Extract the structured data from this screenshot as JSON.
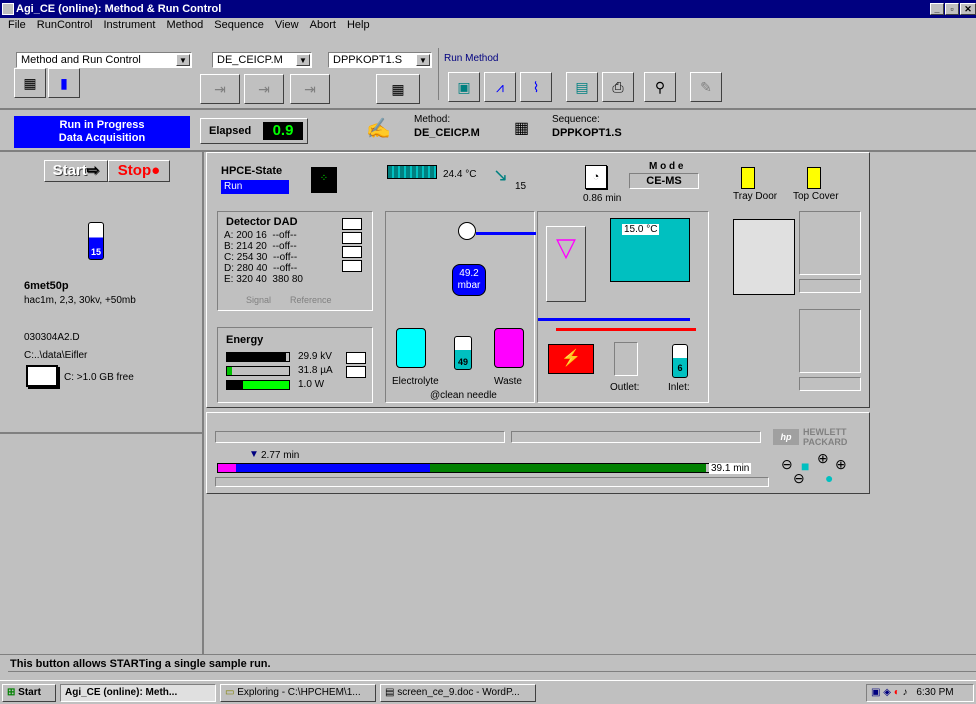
{
  "window": {
    "title": "Agi_CE (online): Method & Run Control"
  },
  "menu": [
    "File",
    "RunControl",
    "Instrument",
    "Method",
    "Sequence",
    "View",
    "Abort",
    "Help"
  ],
  "toolbar": {
    "view_select": "Method and Run Control",
    "method_select": "DE_CEICP.M",
    "sequence_select": "DPPKOPT1.S",
    "run_method_label": "Run Method"
  },
  "status": {
    "line1": "Run in Progress",
    "line2": "Data Acquisition",
    "elapsed_label": "Elapsed",
    "elapsed_value": "0.9",
    "method_label": "Method:",
    "method_value": "DE_CEICP.M",
    "sequence_label": "Sequence:",
    "sequence_value": "DPPKOPT1.S"
  },
  "left": {
    "start_label": "Start",
    "stop_label": "Stop",
    "vial_number": "15",
    "sample_name": "6met50p",
    "sample_desc": "hac1m, 2,3, 30kv, +50mb",
    "datafile": "030304A2.D",
    "datapath": "C:..\\data\\Eifler",
    "disk": "C: >1.0 GB free"
  },
  "hpce": {
    "title": "HPCE-State",
    "state": "Run",
    "temp": "24.4 °C",
    "syringe": "15",
    "time": "0.86 min",
    "mode_label": "M o d e",
    "mode_value": "CE-MS",
    "tray_door": "Tray Door",
    "top_cover": "Top Cover"
  },
  "detector": {
    "title": "Detector DAD",
    "rows": [
      {
        "ch": "A:",
        "sig": "200 16",
        "ref": "--off--"
      },
      {
        "ch": "B:",
        "sig": "214 20",
        "ref": "--off--"
      },
      {
        "ch": "C:",
        "sig": "254 30",
        "ref": "--off--"
      },
      {
        "ch": "D:",
        "sig": "280 40",
        "ref": "--off--"
      },
      {
        "ch": "E:",
        "sig": "320 40",
        "ref": "380 80"
      }
    ],
    "signal_label": "Signal",
    "reference_label": "Reference"
  },
  "energy": {
    "title": "Energy",
    "voltage": "29.9 kV",
    "current": "31.8 µA",
    "power": "1.0 W",
    "voltage_level": 0.95,
    "current_level": 0.08,
    "power_level": 0.25
  },
  "fluidics": {
    "pressure": "49.2",
    "pressure_unit": "mbar",
    "cassette_temp": "15.0 °C",
    "electrolyte": "Electrolyte",
    "waste": "Waste",
    "clean_needle": "@clean needle",
    "vial_mid": "49",
    "outlet": "Outlet:",
    "inlet": "Inlet:",
    "inlet_vial": "6"
  },
  "progress": {
    "marker_time": "2.77 min",
    "end_time": "39.1 min",
    "logo_line1": "HEWLETT",
    "logo_line2": "PACKARD"
  },
  "statusbar": {
    "message": "This button allows STARTing a single sample run."
  },
  "taskbar": {
    "start": "Start",
    "tasks": [
      "Agi_CE (online): Meth...",
      "Exploring - C:\\HPCHEM\\1...",
      "screen_ce_9.doc - WordP..."
    ],
    "clock": "6:30 PM"
  },
  "colors": {
    "run_blue": "#0000ff",
    "lcd_green": "#00ff00",
    "title_blue": "#000080"
  }
}
